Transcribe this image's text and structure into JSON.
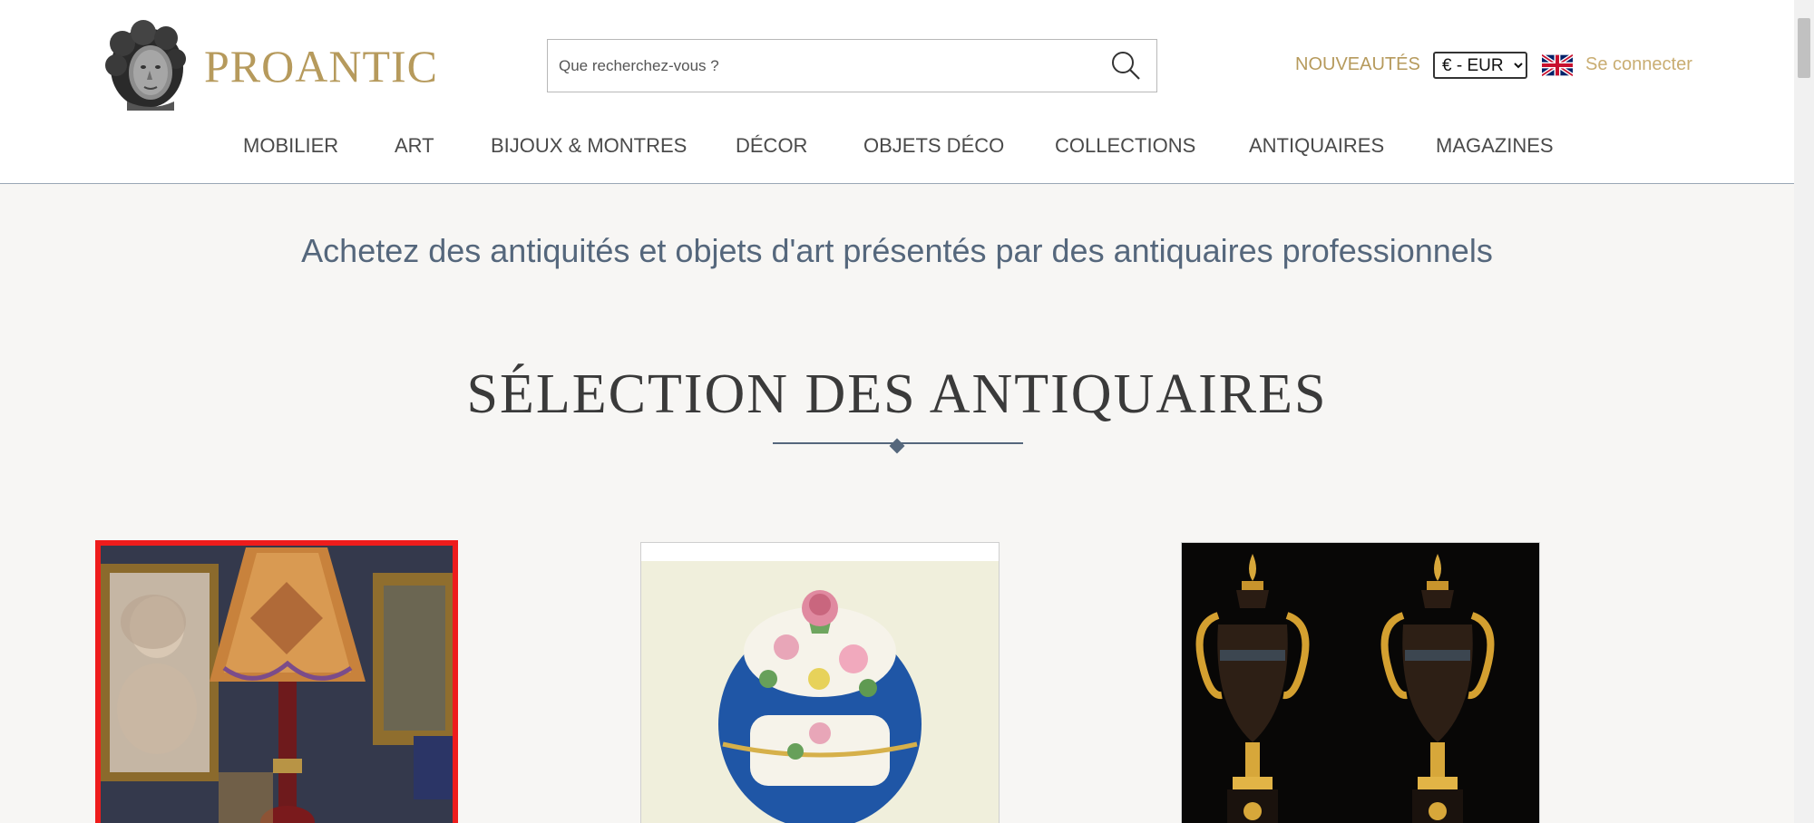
{
  "header": {
    "brand": "PROANTIC",
    "search": {
      "placeholder": "Que recherchez-vous ?",
      "value": ""
    },
    "nouveautes_label": "NOUVEAUTÉS",
    "currency": {
      "selected": "€ - EUR",
      "options": [
        "€ - EUR"
      ]
    },
    "language_flag": "uk-flag-icon",
    "login_label": "Se connecter"
  },
  "nav": {
    "items": [
      {
        "label": "MOBILIER"
      },
      {
        "label": "ART"
      },
      {
        "label": "BIJOUX & MONTRES"
      },
      {
        "label": "DÉCOR"
      },
      {
        "label": "OBJETS DÉCO"
      },
      {
        "label": "COLLECTIONS"
      },
      {
        "label": "ANTIQUAIRES"
      },
      {
        "label": "MAGAZINES"
      }
    ]
  },
  "main": {
    "tagline": "Achetez des antiquités et objets d'art présentés par des antiquaires professionnels",
    "section_title": "SÉLECTION DES ANTIQUAIRES",
    "products": [
      {
        "image": "lamp-and-portrait-image",
        "highlighted": true
      },
      {
        "image": "porcelain-bonbonniere-image",
        "highlighted": false
      },
      {
        "image": "ormolu-cassolettes-pair-image",
        "highlighted": false
      }
    ]
  },
  "colors": {
    "brand_gold": "#b69a5c",
    "login_gold": "#c9ad72",
    "tagline_blue": "#55677c",
    "highlight_red": "#ee1c1c",
    "page_bg": "#f7f6f4"
  }
}
